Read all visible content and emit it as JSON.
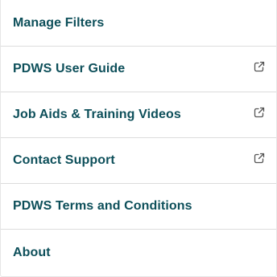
{
  "menu": {
    "items": [
      {
        "label": "Manage Filters",
        "external": false
      },
      {
        "label": "PDWS User Guide",
        "external": true,
        "icon": "external-link-icon"
      },
      {
        "label": "Job Aids & Training Videos",
        "external": true,
        "icon": "external-link-icon"
      },
      {
        "label": "Contact Support",
        "external": true,
        "icon": "external-link-icon"
      },
      {
        "label": "PDWS Terms and Conditions",
        "external": false
      },
      {
        "label": "About",
        "external": false
      }
    ]
  },
  "colors": {
    "text": "#0d4f5a",
    "divider": "#dcdcdc",
    "icon": "#555555",
    "background": "#ffffff"
  }
}
